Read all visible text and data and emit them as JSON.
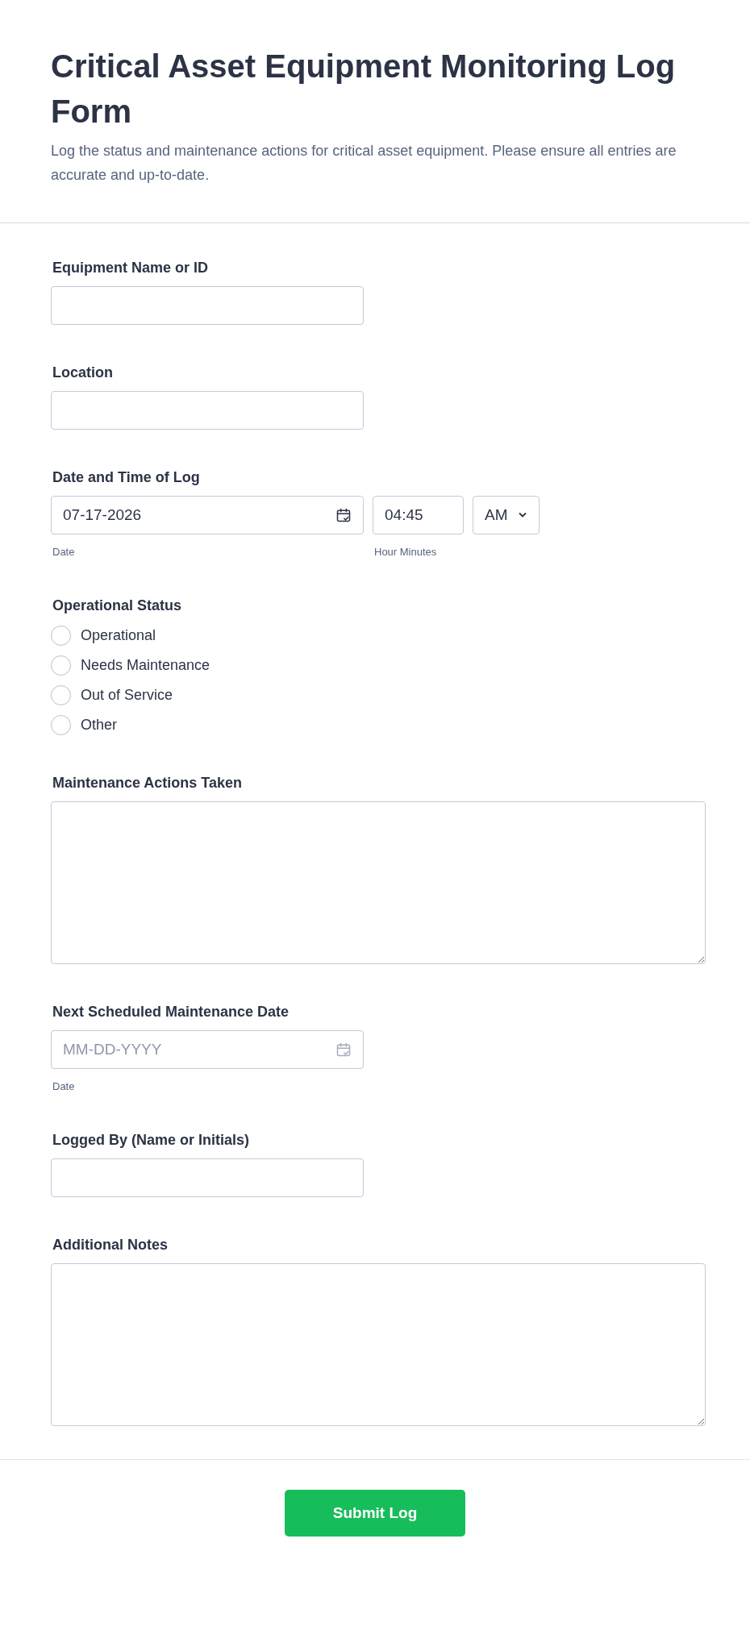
{
  "header": {
    "title": "Critical Asset Equipment Monitoring Log Form",
    "description": "Log the status and maintenance actions for critical asset equipment. Please ensure all entries are accurate and up-to-date."
  },
  "fields": [
    {
      "kind": "text",
      "label": "Equipment Name or ID"
    },
    {
      "kind": "text",
      "label": "Location"
    },
    {
      "kind": "datetime",
      "label": "Date and Time of Log",
      "date": "07-17-2026",
      "date_sublabel": "Date",
      "time": "04:45",
      "time_sublabel": "Hour Minutes",
      "period": "AM"
    },
    {
      "kind": "radio",
      "label": "Operational Status",
      "options": [
        {
          "label": "Operational",
          "selected": false
        },
        {
          "label": "Needs Maintenance",
          "selected": false
        },
        {
          "label": "Out of Service",
          "selected": false
        },
        {
          "label": "Other",
          "selected": false
        }
      ]
    },
    {
      "kind": "textarea",
      "label": "Maintenance Actions Taken"
    },
    {
      "kind": "date",
      "label": "Next Scheduled Maintenance Date",
      "placeholder": "MM-DD-YYYY",
      "sublabel": "Date"
    },
    {
      "kind": "text",
      "label": "Logged By (Name or Initials)"
    },
    {
      "kind": "textarea",
      "label": "Additional Notes"
    }
  ],
  "submit": {
    "label": "Submit Log"
  }
}
